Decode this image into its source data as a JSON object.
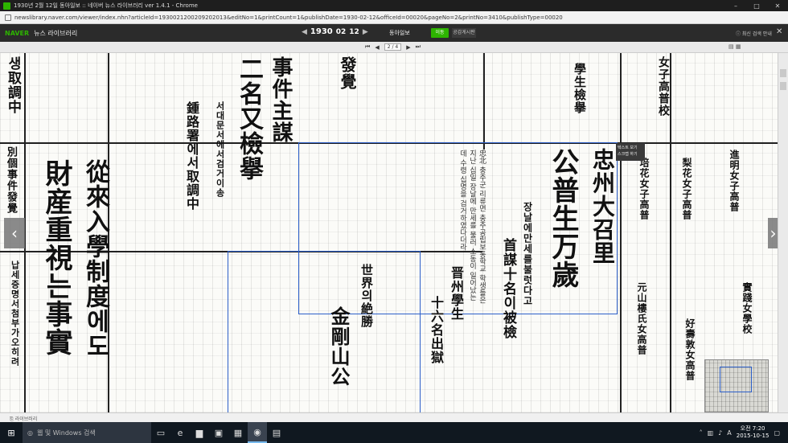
{
  "window": {
    "title": "1930년 2월 12일 동아일보 :: 네이버 뉴스 라이브러리 ver 1.4.1 - Chrome",
    "controls": [
      "–",
      "□",
      "✕"
    ]
  },
  "address": {
    "url": "newslibrary.naver.com/viewer/index.nhn?articleId=1930021200209202013&editNo=1&printCount=1&publishDate=1930-02-12&officeId=00020&pageNo=2&printNo=3410&publishType=00020"
  },
  "naverbar": {
    "brand": "NAVER",
    "service": "뉴스 라이브러리",
    "year": "1930",
    "month": "02",
    "day": "12",
    "paper_name": "동아일보",
    "button_green": "이동",
    "button_dark": "공감게시판",
    "help": "ⓘ 최신 검색 안내",
    "close": "✕"
  },
  "pagebar": {
    "first": "⏮",
    "prev": "◀",
    "page_current": "2",
    "page_total": "4",
    "next": "▶",
    "last": "⏭",
    "mode": "▤ ▦"
  },
  "newspaper": {
    "headlines": {
      "h1": "事件主謀",
      "h2": "二名又檢擧",
      "h3": "從來入學制度에도",
      "h4": "財産重視는事實",
      "h5": "忠州大召里",
      "h6": "公普生万歲",
      "h7": "首謀十名이被檢",
      "h8": "晋州學生",
      "h9": "十六名出獄",
      "h10": "世界의絶勝",
      "h11": "金剛山公",
      "h12": "學生檢擧",
      "h13": "생取調中",
      "h14": "別個事件發覺",
      "h15": "發覺",
      "h16": "女子高普校",
      "h17": "梨花女子高普",
      "h18": "培花女子高普",
      "h19": "進明女子高普",
      "h20": "好壽敦女高普",
      "h21": "元山樓氏女高普",
      "h22": "實踐女學校"
    },
    "subheads": {
      "s1": "서대문서에서검거이송",
      "s2": "鍾路署에서取調中",
      "s3": "장날에만세를불럿다고",
      "s4": "납세증명서첨부가오히려"
    },
    "popup": {
      "line1": "텍스트 보기",
      "line2": "스크랩 하기"
    }
  },
  "statusbar": {
    "text": "⎘ 라이브러리"
  },
  "taskbar": {
    "search_placeholder": "웹 및 Windows 검색",
    "time": "오전 7:20",
    "date": "2015-10-15"
  }
}
